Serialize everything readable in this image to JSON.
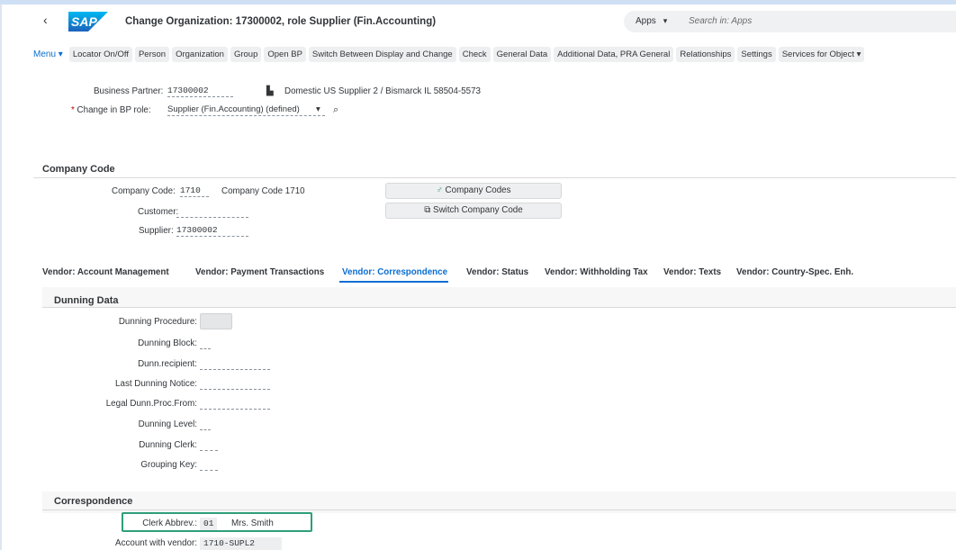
{
  "shell": {
    "back_icon": "chevron-left-icon",
    "logo_text": "SAP",
    "title": "Change Organization: 17300002, role Supplier (Fin.Accounting)",
    "apps_label": "Apps",
    "search_placeholder": "Search in: Apps"
  },
  "toolbar": {
    "menu_label": "Menu",
    "buttons": [
      "Locator On/Off",
      "Person",
      "Organization",
      "Group",
      "Open BP",
      "Switch Between Display and Change",
      "Check",
      "General Data",
      "Additional Data, PRA General",
      "Relationships",
      "Settings",
      "Services for Object"
    ]
  },
  "header_fields": {
    "bp_label": "Business Partner:",
    "bp_value": "17300002",
    "bp_desc": "Domestic US Supplier 2 / Bismarck IL 58504-5573",
    "role_label": "Change in BP role:",
    "role_value": "Supplier (Fin.Accounting) (defined)"
  },
  "company_code": {
    "section_title": "Company Code",
    "cc_label": "Company Code:",
    "cc_value": "1710",
    "cc_desc": "Company Code 1710",
    "customer_label": "Customer:",
    "customer_value": "",
    "supplier_label": "Supplier:",
    "supplier_value": "17300002",
    "btn_company_codes": "Company Codes",
    "btn_switch": "Switch Company Code"
  },
  "tabs": [
    {
      "label": "Vendor: Account Management",
      "active": false
    },
    {
      "label": "Vendor: Payment Transactions",
      "active": false
    },
    {
      "label": "Vendor: Correspondence",
      "active": true
    },
    {
      "label": "Vendor: Status",
      "active": false
    },
    {
      "label": "Vendor: Withholding Tax",
      "active": false
    },
    {
      "label": "Vendor: Texts",
      "active": false
    },
    {
      "label": "Vendor: Country-Spec. Enh.",
      "active": false
    }
  ],
  "dunning": {
    "section_title": "Dunning Data",
    "fields": [
      {
        "label": "Dunning Procedure:",
        "value": ""
      },
      {
        "label": "Dunning Block:",
        "value": ""
      },
      {
        "label": "Dunn.recipient:",
        "value": ""
      },
      {
        "label": "Last Dunning Notice:",
        "value": ""
      },
      {
        "label": "Legal Dunn.Proc.From:",
        "value": ""
      },
      {
        "label": "Dunning Level:",
        "value": ""
      },
      {
        "label": "Dunning Clerk:",
        "value": ""
      },
      {
        "label": "Grouping Key:",
        "value": ""
      }
    ]
  },
  "correspondence": {
    "section_title": "Correspondence",
    "clerk_label": "Clerk Abbrev.:",
    "clerk_value": "01",
    "clerk_name": "Mrs. Smith",
    "account_label": "Account with vendor:",
    "account_value": "1710-SUPL2"
  },
  "colors": {
    "accent": "#0a6ed1",
    "highlight_border": "#2e9e7b",
    "required": "#bb0000"
  }
}
